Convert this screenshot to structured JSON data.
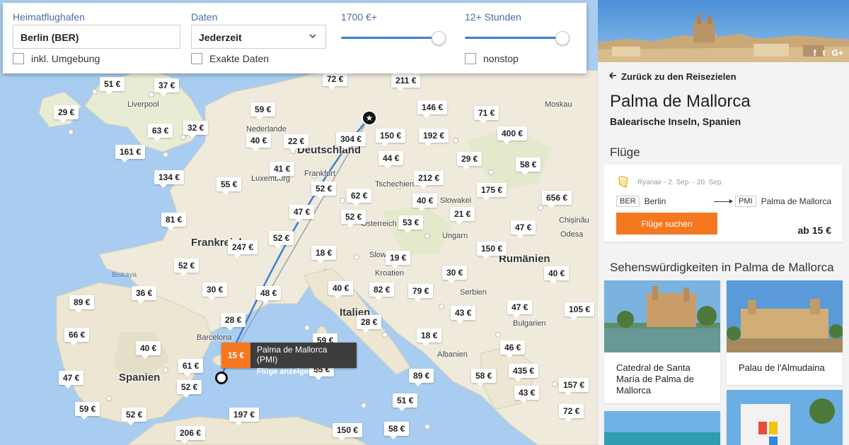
{
  "search": {
    "home_airport_label": "Heimatflughafen",
    "home_airport_value": "Berlin (BER)",
    "include_nearby_label": "inkl. Umgebung",
    "dates_label": "Daten",
    "dates_value": "Jederzeit",
    "exact_dates_label": "Exakte Daten",
    "price_label": "1700 €+",
    "price_fraction": 1.0,
    "duration_label": "12+ Stunden",
    "duration_fraction": 1.0,
    "nonstop_label": "nonstop"
  },
  "map": {
    "countries": [
      "Frankreich",
      "Deutschland",
      "Spanien",
      "Italien",
      "Rumänien",
      "Bulgarien",
      "Kroatien",
      "Ungarn",
      "Österreich",
      "Tschechien",
      "Serbien",
      "Albanien",
      "Slowakei"
    ],
    "cities": [
      "Liverpool",
      "Nederlande",
      "Frankfurt",
      "Luxemburg",
      "Barcelona",
      "Biskaya",
      "Slow",
      "Chișinău",
      "Moskau",
      "Odesa"
    ],
    "prices": [
      "51 €",
      "37 €",
      "29 €",
      "63 €",
      "32 €",
      "161 €",
      "59 €",
      "40 €",
      "22 €",
      "72 €",
      "211 €",
      "146 €",
      "71 €",
      "304 €",
      "150 €",
      "192 €",
      "400 €",
      "44 €",
      "29 €",
      "58 €",
      "134 €",
      "41 €",
      "55 €",
      "52 €",
      "62 €",
      "212 €",
      "175 €",
      "656 €",
      "40 €",
      "47 €",
      "81 €",
      "52 €",
      "21 €",
      "53 €",
      "47 €",
      "52 €",
      "247 €",
      "18 €",
      "150 €",
      "19 €",
      "52 €",
      "30 €",
      "40 €",
      "36 €",
      "30 €",
      "48 €",
      "40 €",
      "82 €",
      "79 €",
      "89 €",
      "105 €",
      "28 €",
      "43 €",
      "47 €",
      "28 €",
      "66 €",
      "18 €",
      "59 €",
      "40 €",
      "46 €",
      "61 €",
      "55 €",
      "89 €",
      "58 €",
      "435 €",
      "47 €",
      "52 €",
      "43 €",
      "157 €",
      "51 €",
      "59 €",
      "52 €",
      "197 €",
      "72 €",
      "206 €",
      "150 €",
      "58 €"
    ],
    "popup": {
      "price": "15 €",
      "title": "Palma de Mallorca (PMI)",
      "link": "Flüge anzeigen",
      "chevron": "›"
    },
    "origin_icon": "★"
  },
  "sidebar": {
    "social": [
      "f",
      "t",
      "G+"
    ],
    "back_label": "Zurück zu den Reisezielen",
    "destination_title": "Palma de Mallorca",
    "destination_subtitle": "Balearische Inseln, Spanien",
    "flights_heading": "Flüge",
    "flight": {
      "airline_text": "Ryanair - 2. Sep. - 20. Sep.",
      "from_code": "BER",
      "from_city": "Berlin",
      "to_code": "PMI",
      "to_city": "Palma de Mallorca",
      "button_label": "Flüge suchen",
      "price_label": "ab 15 €"
    },
    "sights_heading": "Sehenswürdigkeiten in Palma de Mallorca",
    "sights": [
      {
        "name": "Catedral de Santa María de Palma de Mallorca"
      },
      {
        "name": "Palau de l'Almudaina"
      }
    ]
  },
  "colors": {
    "accent": "#f47820",
    "route": "#3b7fd9",
    "label_blue": "#4a6d9e",
    "sea": "#a9cdf0",
    "land": "#f1ecdb"
  }
}
